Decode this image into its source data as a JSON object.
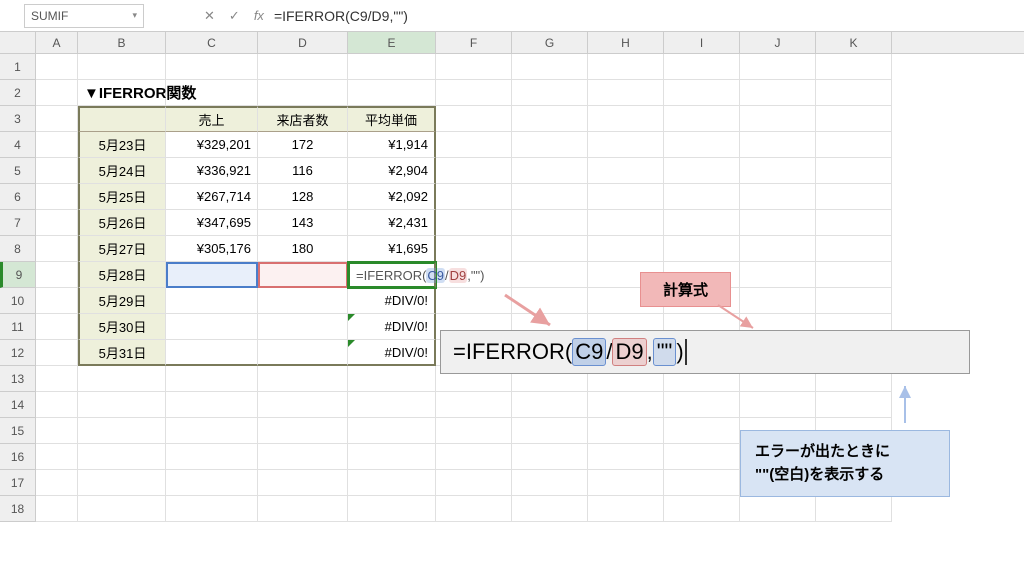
{
  "formula_bar": {
    "name_box": "SUMIF",
    "formula": "=IFERROR(C9/D9,\"\")"
  },
  "columns": [
    "A",
    "B",
    "C",
    "D",
    "E",
    "F",
    "G",
    "H",
    "I",
    "J",
    "K"
  ],
  "active_col": "E",
  "active_row": "9",
  "title": "▼IFERROR関数",
  "headers": {
    "sales": "売上",
    "visitors": "来店者数",
    "avg_price": "平均単価"
  },
  "rows": [
    {
      "date": "5月23日",
      "sales": "¥329,201",
      "visitors": "172",
      "avg": "¥1,914"
    },
    {
      "date": "5月24日",
      "sales": "¥336,921",
      "visitors": "116",
      "avg": "¥2,904"
    },
    {
      "date": "5月25日",
      "sales": "¥267,714",
      "visitors": "128",
      "avg": "¥2,092"
    },
    {
      "date": "5月26日",
      "sales": "¥347,695",
      "visitors": "143",
      "avg": "¥2,431"
    },
    {
      "date": "5月27日",
      "sales": "¥305,176",
      "visitors": "180",
      "avg": "¥1,695"
    },
    {
      "date": "5月28日",
      "sales": "",
      "visitors": "",
      "avg": ""
    },
    {
      "date": "5月29日",
      "sales": "",
      "visitors": "",
      "avg": "#DIV/0!"
    },
    {
      "date": "5月30日",
      "sales": "",
      "visitors": "",
      "avg": "#DIV/0!"
    },
    {
      "date": "5月31日",
      "sales": "",
      "visitors": "",
      "avg": "#DIV/0!"
    }
  ],
  "inline_formula": {
    "pre": "=IFERROR(",
    "r1": "C9",
    "mid": "/",
    "r2": "D9",
    "post": ",\"\")"
  },
  "annotations": {
    "label_formula": "計算式",
    "big_formula": {
      "pre": "=IFERROR(",
      "r1": "C9",
      "slash": "/",
      "r2": "D9",
      "comma": ",",
      "r3": "\"\"",
      "post": ")"
    },
    "explain_line1": "エラーが出たときに",
    "explain_line2": "\"\"(空白)を表示する"
  },
  "icons": {
    "cancel": "✕",
    "accept": "✓",
    "fx": "fx",
    "dd": "▾"
  }
}
